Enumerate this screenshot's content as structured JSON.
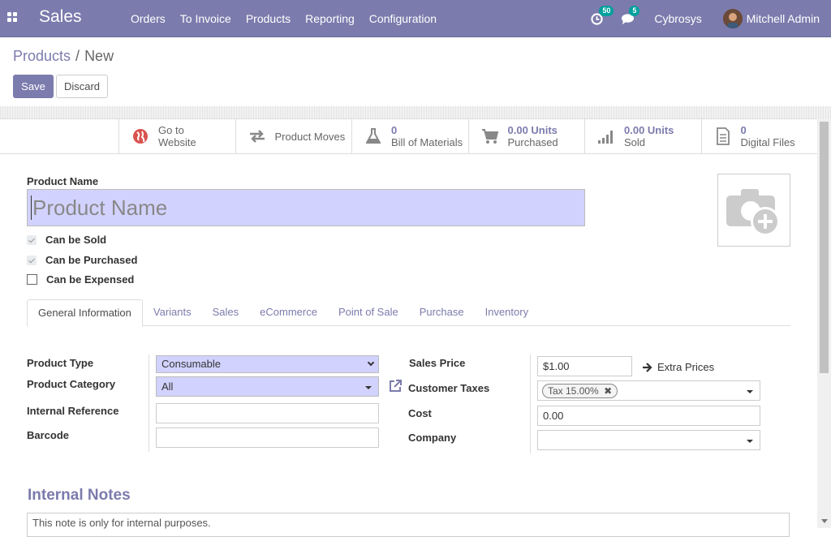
{
  "navbar": {
    "app_name": "Sales",
    "menu": [
      "Orders",
      "To Invoice",
      "Products",
      "Reporting",
      "Configuration"
    ],
    "activity_count": "50",
    "messages_count": "5",
    "company": "Cybrosys",
    "user": "Mitchell Admin"
  },
  "breadcrumb": {
    "parent": "Products",
    "separator": "/",
    "current": "New"
  },
  "actions": {
    "save": "Save",
    "discard": "Discard"
  },
  "smart_buttons": {
    "website": {
      "line1": "Go to",
      "line2": "Website"
    },
    "moves": {
      "label": "Product Moves"
    },
    "bom": {
      "value": "0",
      "label": "Bill of Materials"
    },
    "purchased": {
      "value": "0.00 Units",
      "label": "Purchased"
    },
    "sold": {
      "value": "0.00 Units",
      "label": "Sold"
    },
    "files": {
      "value": "0",
      "label": "Digital Files"
    }
  },
  "form": {
    "name_label": "Product Name",
    "name_placeholder": "Product Name",
    "checkboxes": [
      {
        "label": "Can be Sold",
        "checked": true
      },
      {
        "label": "Can be Purchased",
        "checked": true
      },
      {
        "label": "Can be Expensed",
        "checked": false
      }
    ]
  },
  "tabs": [
    "General Information",
    "Variants",
    "Sales",
    "eCommerce",
    "Point of Sale",
    "Purchase",
    "Inventory"
  ],
  "general": {
    "product_type_label": "Product Type",
    "product_type": "Consumable",
    "category_label": "Product Category",
    "category": "All",
    "internal_ref_label": "Internal Reference",
    "internal_ref": "",
    "barcode_label": "Barcode",
    "barcode": "",
    "sales_price_label": "Sales Price",
    "sales_price": "$1.00",
    "extra_prices": "Extra Prices",
    "taxes_label": "Customer Taxes",
    "tax_tag": "Tax 15.00%",
    "cost_label": "Cost",
    "cost": "0.00",
    "company_label": "Company",
    "company": ""
  },
  "notes": {
    "title": "Internal Notes",
    "placeholder": "This note is only for internal purposes."
  },
  "colors": {
    "brand": "#7c7bad",
    "required_bg": "#d2d2ff",
    "badge": "#00a09d"
  }
}
